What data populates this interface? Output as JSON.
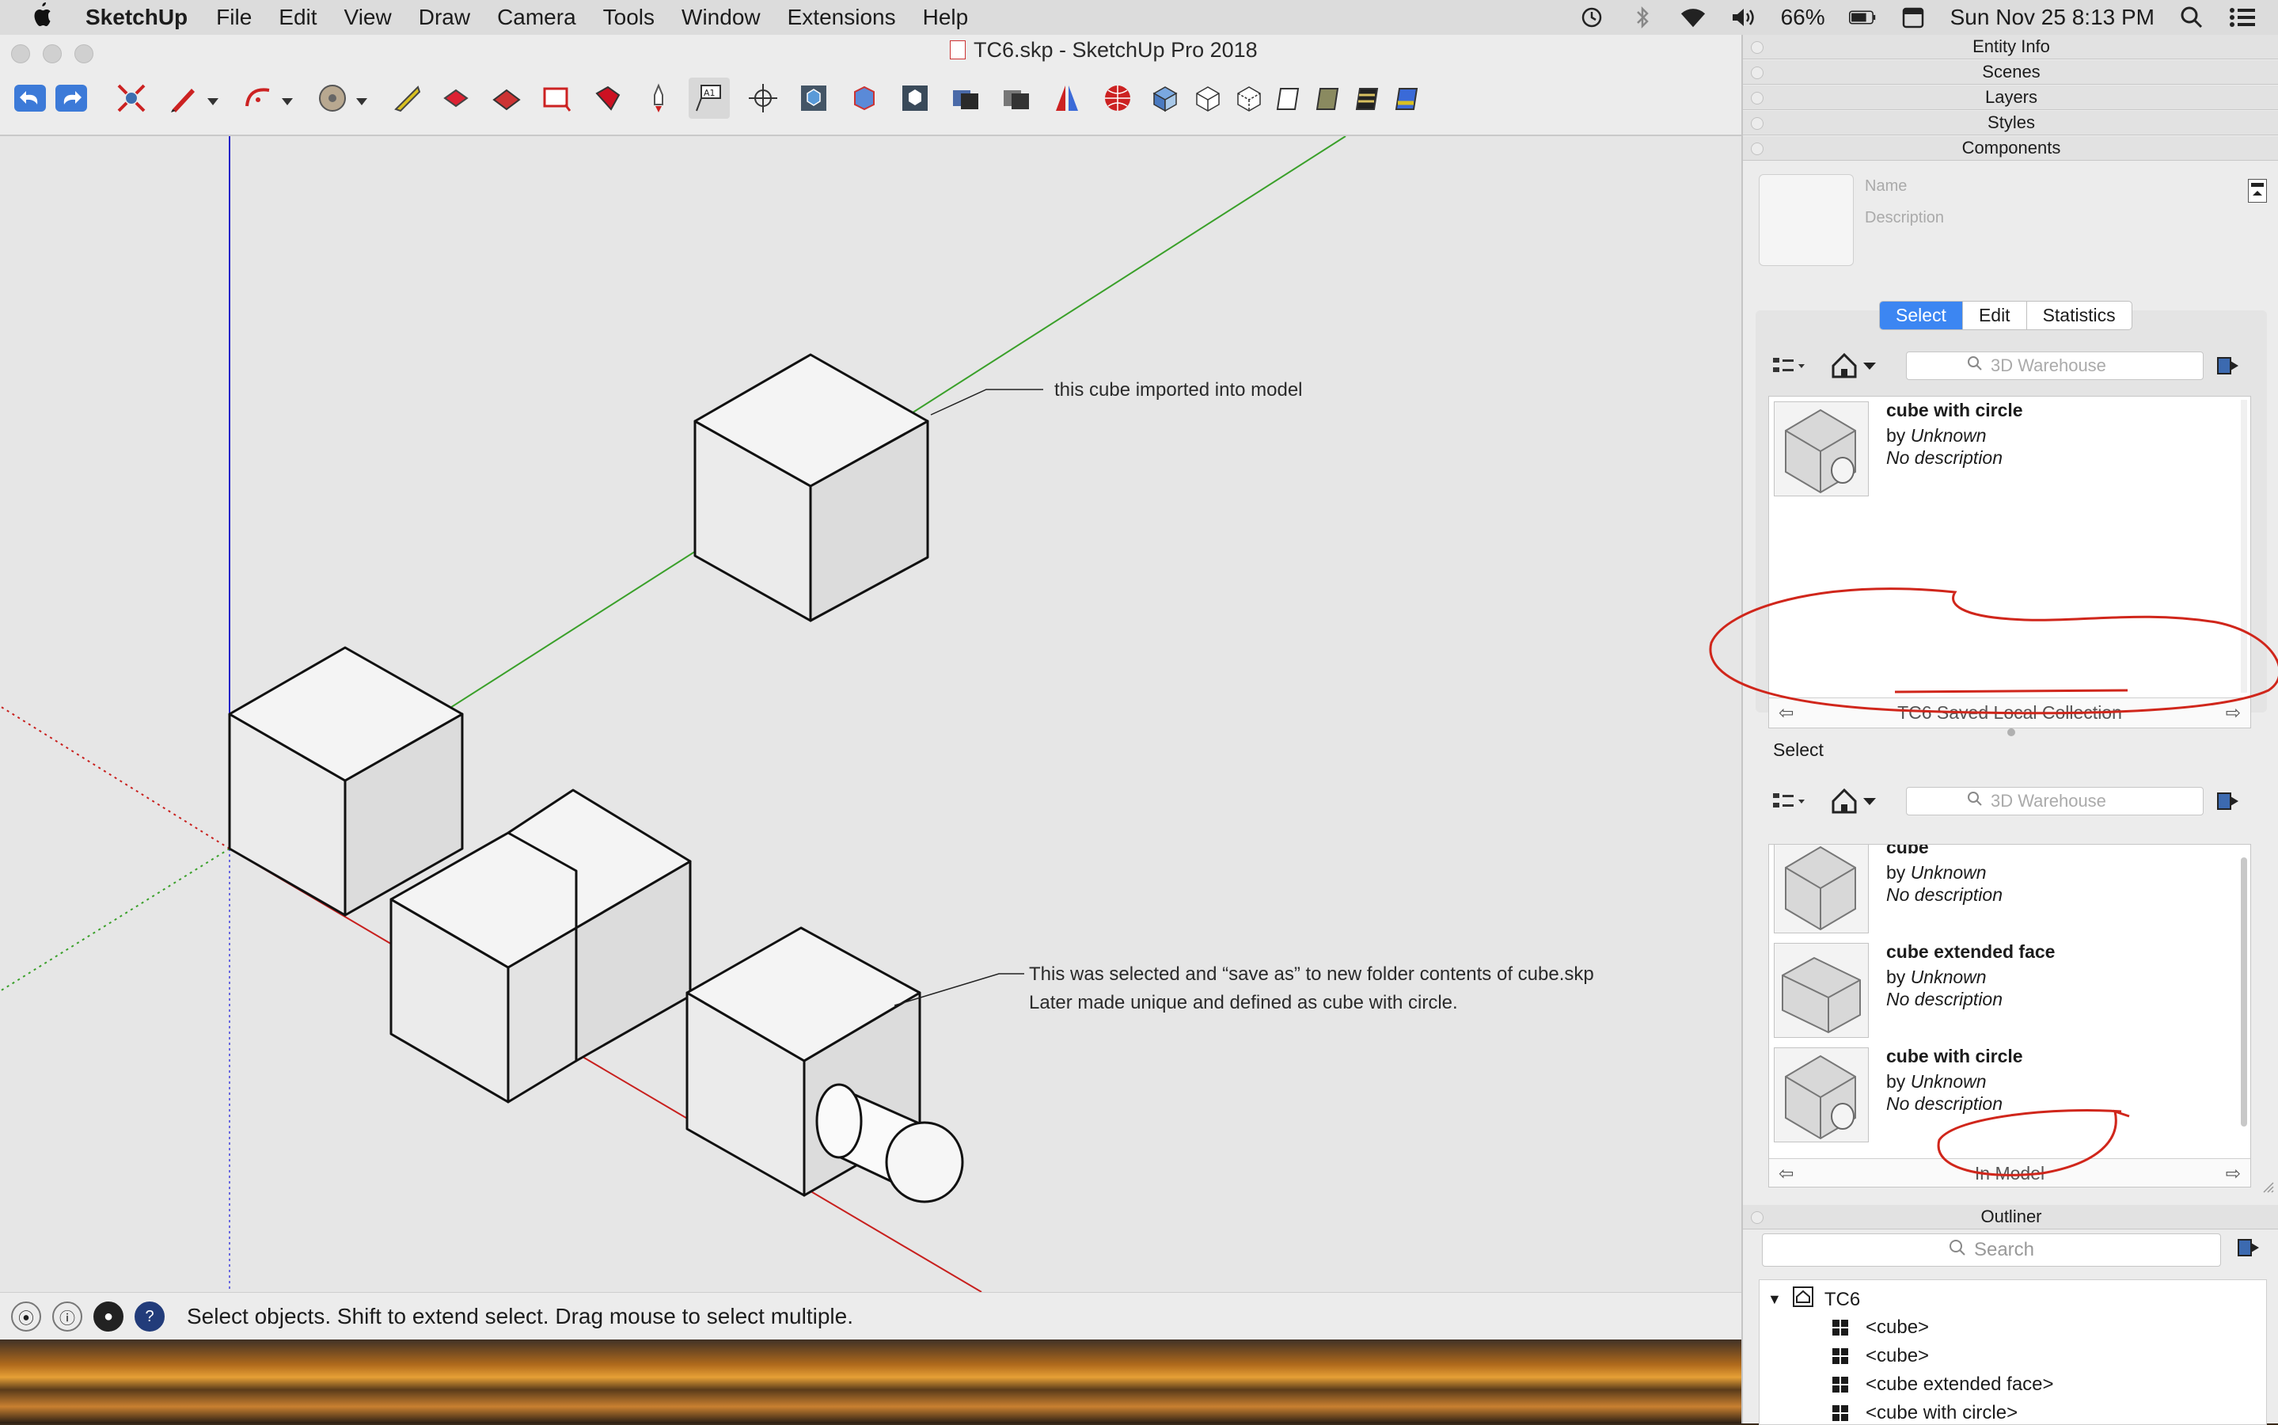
{
  "menubar": {
    "app_name": "SketchUp",
    "items": [
      "File",
      "Edit",
      "View",
      "Draw",
      "Camera",
      "Tools",
      "Window",
      "Extensions",
      "Help"
    ],
    "battery": "66%",
    "datetime": "Sun Nov 25  8:13 PM"
  },
  "window": {
    "title": "TC6.skp - SketchUp Pro 2018"
  },
  "viewport": {
    "annotation_1": "this cube imported into model",
    "annotation_2_line1": "This was  selected and “save as” to new folder contents of cube.skp",
    "annotation_2_line2": "Later made unique and defined as cube with circle."
  },
  "statusbar": {
    "text": "Select objects. Shift to extend select. Drag mouse to select multiple."
  },
  "tray": {
    "panels": [
      "Entity Info",
      "Scenes",
      "Layers",
      "Styles",
      "Components"
    ],
    "components": {
      "name_placeholder": "Name",
      "description_placeholder": "Description",
      "tabs": [
        "Select",
        "Edit",
        "Statistics"
      ],
      "active_tab": "Select",
      "search_placeholder": "3D Warehouse",
      "top_list": {
        "items": [
          {
            "name": "cube with circle",
            "by": "by",
            "author": "Unknown",
            "desc": "No description"
          }
        ],
        "collection": "TC6 Saved Local Collection"
      },
      "secondary_label": "Select",
      "bottom_list": {
        "items": [
          {
            "name": "cube",
            "by": "by",
            "author": "Unknown",
            "desc": "No description"
          },
          {
            "name": "cube extended face",
            "by": "by",
            "author": "Unknown",
            "desc": "No description"
          },
          {
            "name": "cube with circle",
            "by": "by",
            "author": "Unknown",
            "desc": "No description"
          }
        ],
        "collection": "In Model"
      }
    },
    "outliner": {
      "title": "Outliner",
      "search_placeholder": "Search",
      "root": "TC6",
      "children": [
        "<cube>",
        "<cube>",
        "<cube extended face>",
        "<cube with circle>"
      ]
    }
  },
  "colors": {
    "accent": "#3c86f2",
    "axis_red": "#c8201e",
    "axis_green": "#3aa02a",
    "axis_blue": "#2323c8",
    "markup_red": "#d0261b"
  }
}
